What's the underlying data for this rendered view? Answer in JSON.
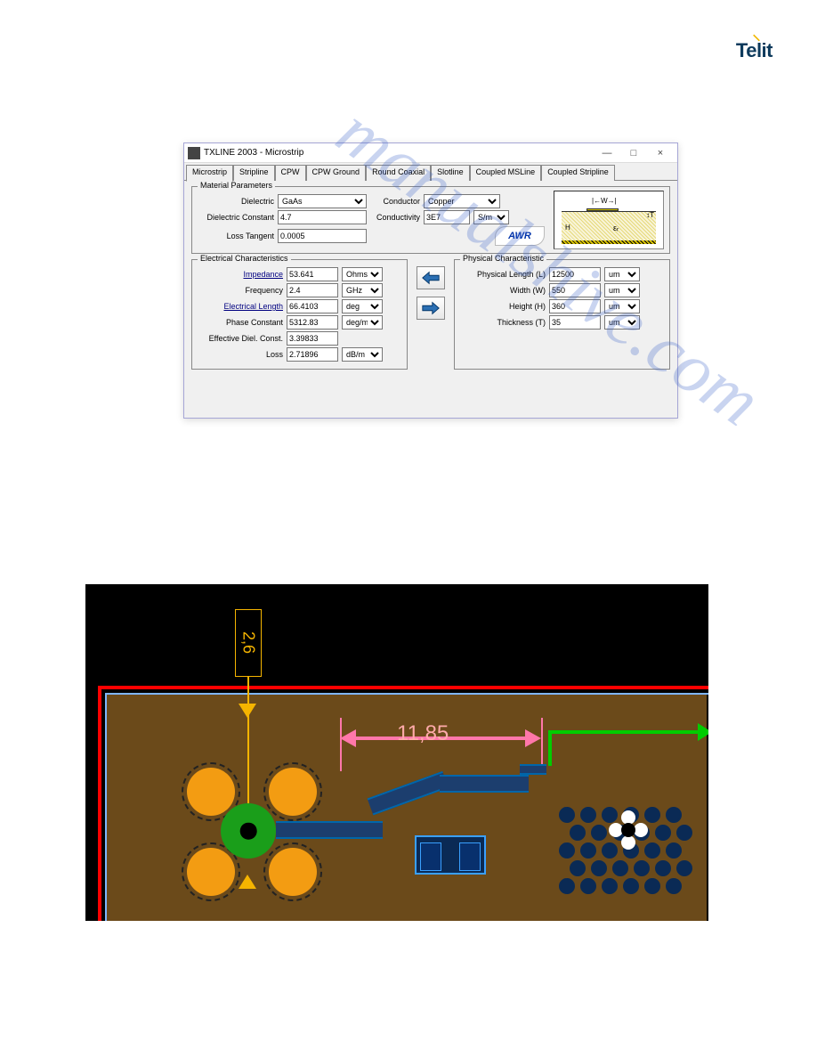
{
  "logo": {
    "text": "Telit"
  },
  "watermark": "manualshive.com",
  "window": {
    "title": "TXLINE 2003 - Microstrip",
    "controls": {
      "min": "—",
      "max": "□",
      "close": "×"
    },
    "tabs": [
      "Microstrip",
      "Stripline",
      "CPW",
      "CPW Ground",
      "Round Coaxial",
      "Slotline",
      "Coupled MSLine",
      "Coupled Stripline"
    ],
    "active_tab": "Microstrip"
  },
  "material": {
    "title": "Material Parameters",
    "dielectric_label": "Dielectric",
    "dielectric_value": "GaAs",
    "dielectric_const_label": "Dielectric Constant",
    "dielectric_const_value": "4.7",
    "loss_tangent_label": "Loss Tangent",
    "loss_tangent_value": "0.0005",
    "conductor_label": "Conductor",
    "conductor_value": "Copper",
    "conductivity_label": "Conductivity",
    "conductivity_value": "3E7",
    "conductivity_unit": "S/m",
    "logo": "AWR"
  },
  "diagram": {
    "w": "|←W→|",
    "t": "↕T",
    "h": "H",
    "er": "εᵣ"
  },
  "electrical": {
    "title": "Electrical Characteristics",
    "impedance_label": "Impedance",
    "impedance_value": "53.641",
    "impedance_unit": "Ohms",
    "frequency_label": "Frequency",
    "frequency_value": "2.4",
    "frequency_unit": "GHz",
    "elec_length_label": "Electrical Length",
    "elec_length_value": "66.4103",
    "elec_length_unit": "deg",
    "phase_const_label": "Phase Constant",
    "phase_const_value": "5312.83",
    "phase_const_unit": "deg/m",
    "eff_diel_label": "Effective Diel. Const.",
    "eff_diel_value": "3.39833",
    "loss_label": "Loss",
    "loss_value": "2.71896",
    "loss_unit": "dB/m"
  },
  "physical": {
    "title": "Physical Characteristic",
    "length_label": "Physical Length (L)",
    "length_value": "12500",
    "length_unit": "um",
    "width_label": "Width (W)",
    "width_value": "550",
    "width_unit": "um",
    "height_label": "Height (H)",
    "height_value": "360",
    "height_unit": "um",
    "thickness_label": "Thickness (T)",
    "thickness_value": "35",
    "thickness_unit": "um"
  },
  "pcb": {
    "dim_vertical": "2,6",
    "dim_horizontal": "11,85"
  }
}
